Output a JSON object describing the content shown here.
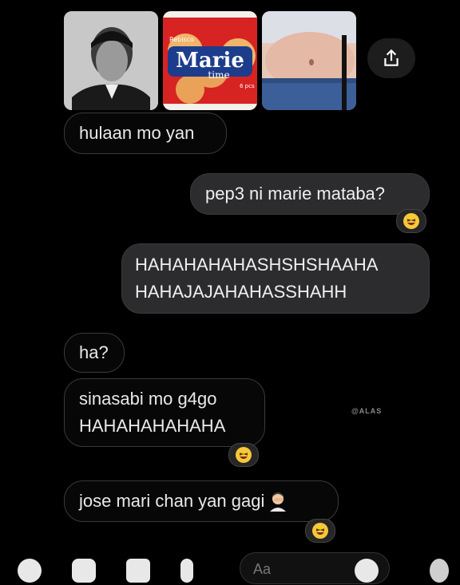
{
  "messages": [
    {
      "id": "m1",
      "side": "received",
      "text": "hulaan mo yan"
    },
    {
      "id": "m2",
      "side": "sent",
      "text": "pep3 ni marie mataba?",
      "reaction": "laughing-face"
    },
    {
      "id": "m3",
      "side": "sent",
      "lines": [
        "HAHAHAHAHASHSHSHAAHA",
        "HAHAJAJAHAHASSHAHH"
      ]
    },
    {
      "id": "m4",
      "side": "received",
      "text": "ha?"
    },
    {
      "id": "m5",
      "side": "received",
      "lines": [
        "sinasabi mo g4go",
        "HAHAHAHAHAHA"
      ],
      "reaction": "laughing-face"
    },
    {
      "id": "m6",
      "side": "received",
      "text": "jose mari chan yan gagi",
      "trailing_emoji": "man-facepalming",
      "reaction": "laughing-face"
    }
  ],
  "photos": [
    {
      "name": "portrait-photo"
    },
    {
      "name": "marie-biscuit-pack-photo",
      "brand_top": "Rebisco",
      "title": "Marie",
      "subtitle": "time",
      "note": "6 pcs"
    },
    {
      "name": "belly-photo"
    }
  ],
  "watermark": "@ALAS",
  "composer": {
    "placeholder": "Aa"
  },
  "colors": {
    "background": "#000000",
    "sent_bubble": "#2c2c2e",
    "received_border": "#3a3a3a",
    "reaction": "#f6c83a"
  }
}
